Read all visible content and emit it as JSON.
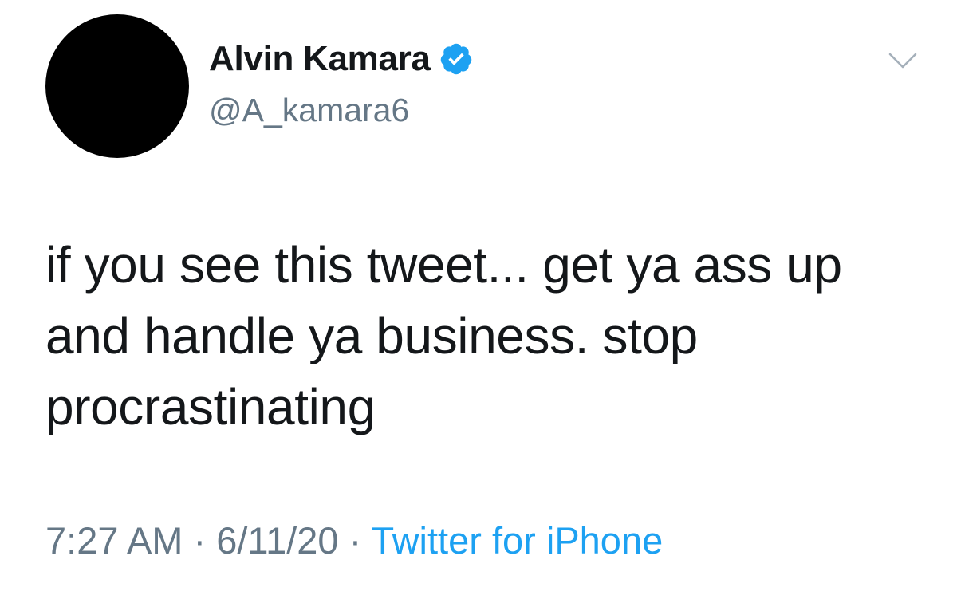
{
  "author": {
    "display_name": "Alvin Kamara",
    "handle": "@A_kamara6",
    "verified": true
  },
  "tweet": {
    "lines": [
      "if you see this tweet... get ya ass up",
      "and handle ya business. stop",
      "procrastinating"
    ],
    "time": "7:27 AM",
    "date": "6/11/20",
    "separator": "·",
    "source": "Twitter for iPhone"
  },
  "icons": {
    "verified": "verified-badge-icon",
    "menu": "chevron-down-icon"
  },
  "colors": {
    "text": "#14171a",
    "secondary": "#657786",
    "accent": "#1da1f2",
    "avatar": "#000000"
  }
}
